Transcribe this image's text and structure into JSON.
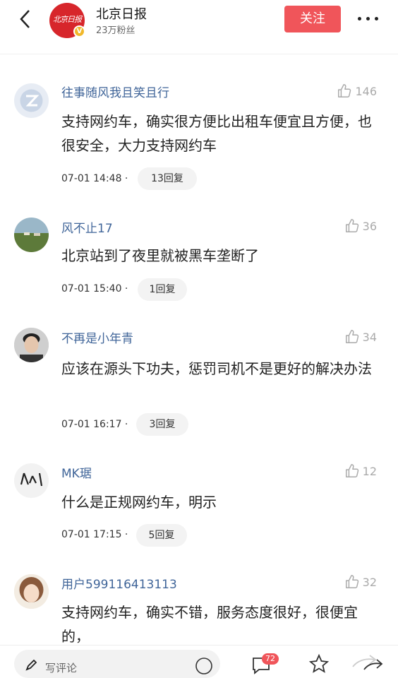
{
  "header": {
    "publisher_name": "北京日报",
    "fans": "23万粉丝",
    "logo_text": "北京日报",
    "follow_label": "关注"
  },
  "comments": [
    {
      "user": "往事随风我且笑且行",
      "likes": "146",
      "text": "支持网约车，确实很方便比出租车便宜且方便，也很安全，大力支持网约车",
      "time": "07-01 14:48 ·",
      "replies": "13回复"
    },
    {
      "user": "风不止17",
      "likes": "36",
      "text": "北京站到了夜里就被黑车垄断了",
      "time": "07-01 15:40 ·",
      "replies": "1回复"
    },
    {
      "user": "不再是小年青",
      "likes": "34",
      "text": "应该在源头下功夫，惩罚司机不是更好的解决办法",
      "time": "07-01 16:17 ·",
      "replies": "3回复"
    },
    {
      "user": "MK琚",
      "likes": "12",
      "text": "什么是正规网约车，明示",
      "time": "07-01 17:15 ·",
      "replies": "5回复"
    },
    {
      "user": "用户599116413113",
      "likes": "32",
      "text": "支持网约车，确实不错，服务态度很好，很便宜的，",
      "time": "",
      "replies": ""
    }
  ],
  "bottom_bar": {
    "write_placeholder": "写评论",
    "comment_count": "72"
  },
  "colors": {
    "accent": "#f0555a",
    "username": "#406599",
    "logo_red": "#d7262b",
    "verified": "#f1b82b"
  },
  "icons": [
    "back-arrow-icon",
    "verified-badge-icon",
    "more-icon",
    "thumbs-up-icon",
    "pencil-icon",
    "emoji-icon",
    "comment-icon",
    "star-icon",
    "share-icon"
  ]
}
